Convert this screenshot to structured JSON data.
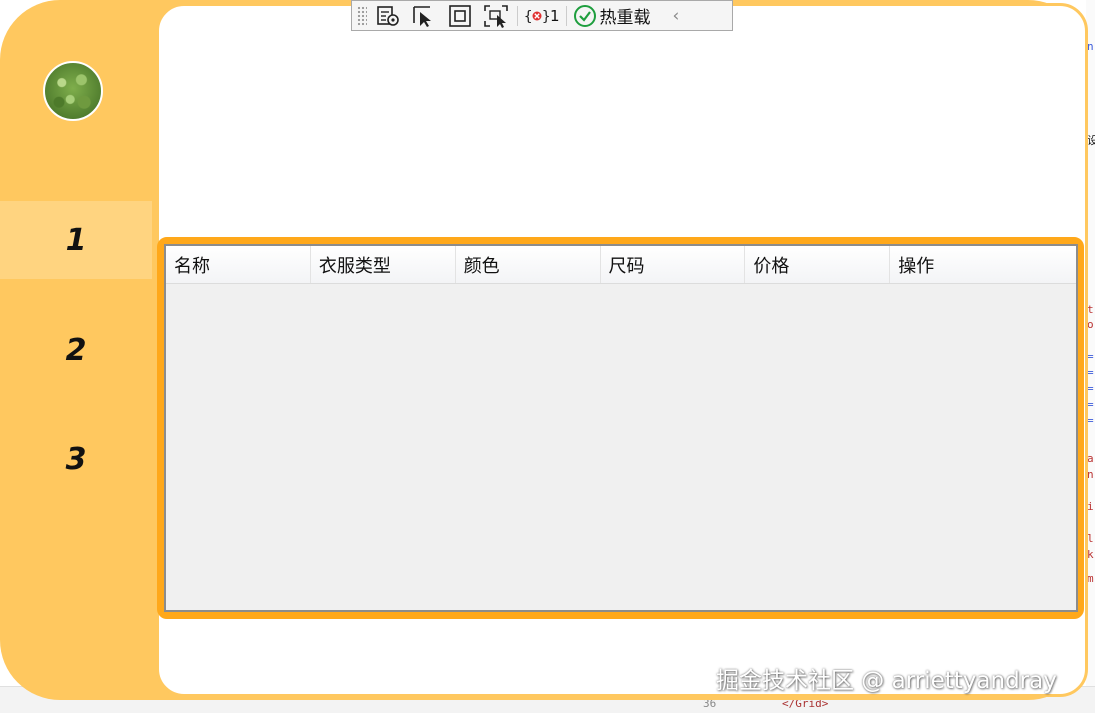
{
  "toolbar": {
    "error_count": "1",
    "hot_reload_label": "热重载",
    "icons": [
      "select-element-icon",
      "pointer-select-icon",
      "layout-adorner-icon",
      "track-focus-icon",
      "binding-failures-icon",
      "check-circle-icon",
      "chevron-left-icon"
    ]
  },
  "sidebar": {
    "items": [
      {
        "label": "1",
        "active": true
      },
      {
        "label": "2",
        "active": false
      },
      {
        "label": "3",
        "active": false
      }
    ]
  },
  "grid": {
    "columns": [
      "名称",
      "衣服类型",
      "颜色",
      "尺码",
      "价格",
      "操作"
    ],
    "rows": []
  },
  "background_ide": {
    "line_number": "36",
    "tag_text": "</Grid>"
  },
  "watermark": "掘金技术社区 @ arriettyandray",
  "colors": {
    "sidebar": "#ffc85f",
    "active_item": "#ffd480",
    "grid_border": "#ffa81a",
    "content_bg": "#ffffff",
    "grid_bg": "#f0f0f0"
  }
}
